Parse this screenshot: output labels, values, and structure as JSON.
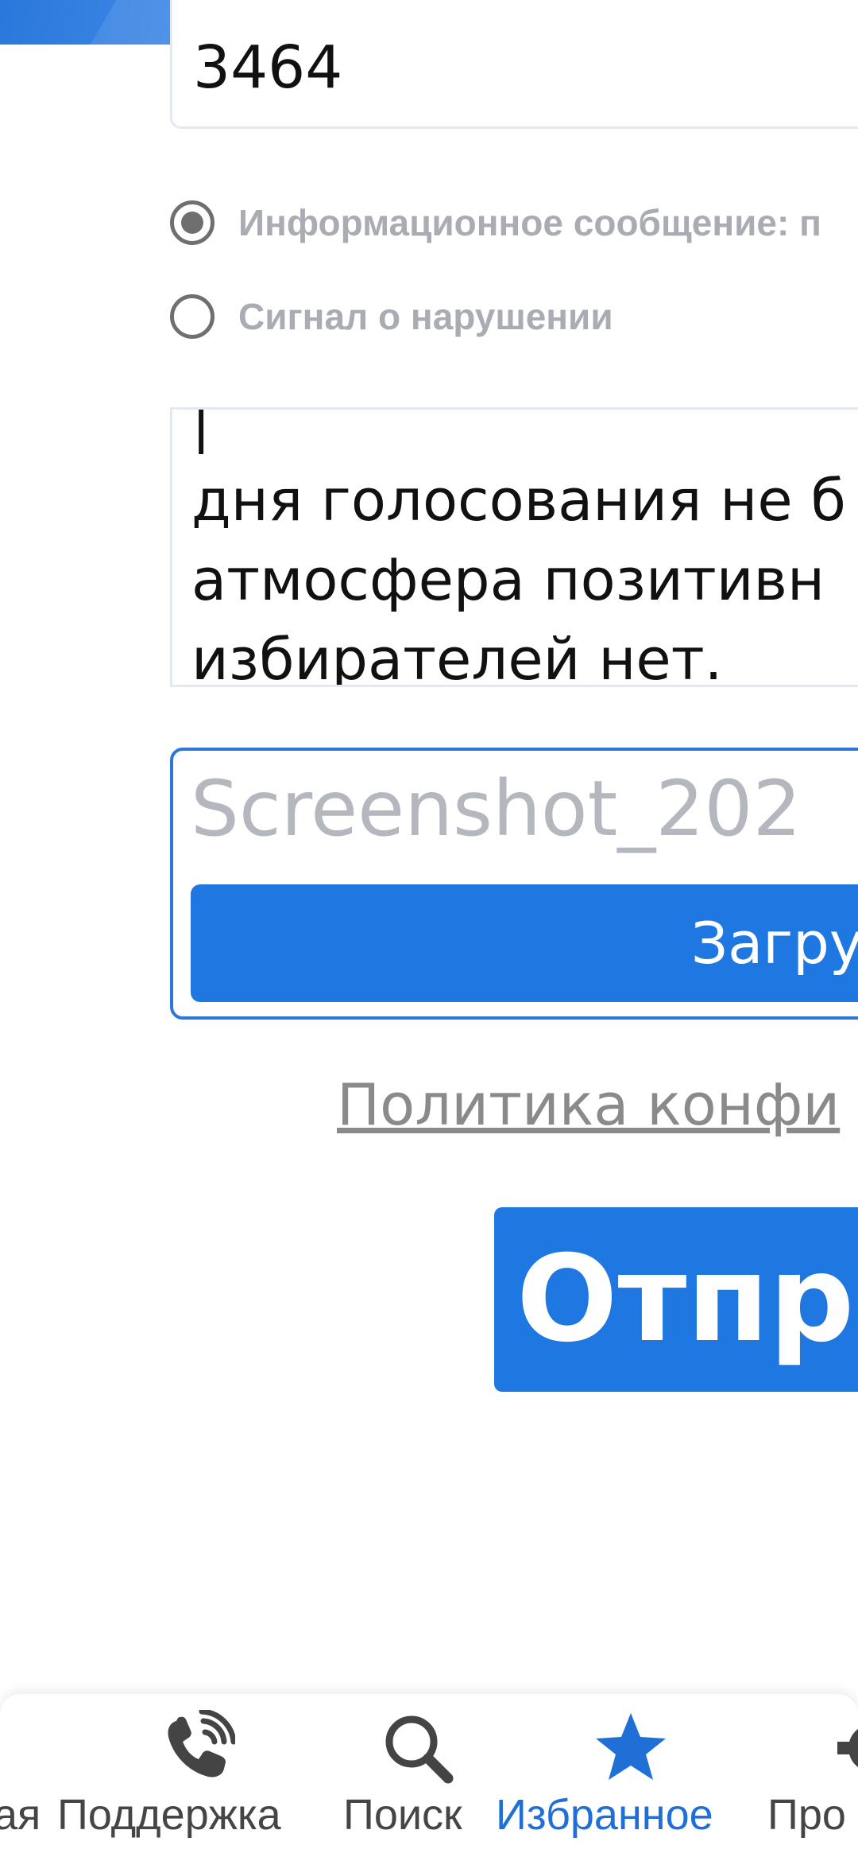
{
  "form": {
    "number_value": "3464",
    "radio_options": [
      {
        "label": "Информационное сообщение: п",
        "checked": true
      },
      {
        "label": "Сигнал о нарушении",
        "checked": false
      }
    ],
    "message_text": "|\nдня голосования не б\nатмосфера позитивн\nизбирателей  нет.",
    "upload": {
      "filename": "Screenshot_202",
      "button_label": "Загру"
    },
    "privacy_link": "Политика конфи",
    "submit_label": "Отпра"
  },
  "bottom_nav": {
    "items": [
      {
        "label": "ая",
        "icon": "home-icon"
      },
      {
        "label": "Поддержка",
        "icon": "phone-icon"
      },
      {
        "label": "Поиск",
        "icon": "search-icon"
      },
      {
        "label": "Избранное",
        "icon": "star-icon",
        "active": true
      },
      {
        "label": "Про",
        "icon": "gear-icon"
      }
    ]
  },
  "colors": {
    "accent": "#1f78e2",
    "active_nav": "#1f6fd6",
    "muted_text": "#a9adb3"
  }
}
